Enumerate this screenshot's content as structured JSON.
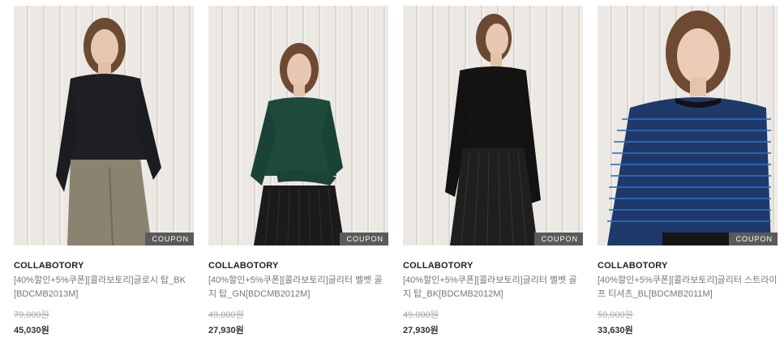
{
  "products": [
    {
      "image_icon": "model-black-satin-top-photo",
      "coupon": "COUPON",
      "brand": "COLLABOTORY",
      "name": "[40%할인+5%쿠폰][콜라보토리]글로시 탑_BK[BDCMB2013M]",
      "original_price": "79,000원",
      "sale_price": "45,030원",
      "top_color": "#1d1f22",
      "bottom_color": "#8a8370"
    },
    {
      "image_icon": "model-green-velvet-top-photo",
      "coupon": "COUPON",
      "brand": "COLLABOTORY",
      "name": "[40%할인+5%쿠폰][콜라보토리]글리터 벨벳 골지 탑_GN[BDCMB2012M]",
      "original_price": "49,000원",
      "sale_price": "27,930원",
      "top_color": "#1e4a3c",
      "bottom_color": "#1b1b1b"
    },
    {
      "image_icon": "model-black-velvet-top-photo",
      "coupon": "COUPON",
      "brand": "COLLABOTORY",
      "name": "[40%할인+5%쿠폰][콜라보토리]글리터 벨벳 골지 탑_BK[BDCMB2012M]",
      "original_price": "49,000원",
      "sale_price": "27,930원",
      "top_color": "#141414",
      "bottom_color": "#1f1f1f"
    },
    {
      "image_icon": "model-blue-stripe-tee-photo",
      "coupon": "COUPON",
      "brand": "COLLABOTORY",
      "name": "[40%할인+5%쿠폰][콜라보토리]글리터 스트라이프 티셔츠_BL[BDCMB2011M]",
      "original_price": "59,000원",
      "sale_price": "33,630원",
      "top_color": "#1f3a6a",
      "bottom_color": "#151515"
    }
  ]
}
